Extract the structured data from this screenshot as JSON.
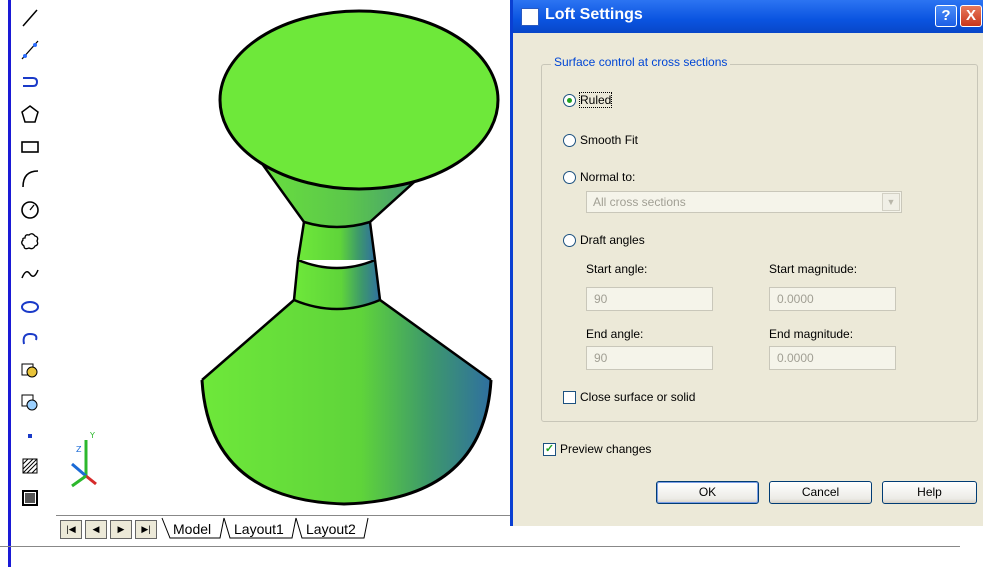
{
  "toolbar": {
    "tools": [
      "line-icon",
      "construction-line-icon",
      "polyline-icon",
      "polygon-icon",
      "rectangle-icon",
      "arc-icon",
      "circle-icon",
      "revision-cloud-icon",
      "spline-icon",
      "ellipse-icon",
      "ellipse-arc-icon",
      "insert-block-icon",
      "make-block-icon",
      "point-icon",
      "hatch-icon",
      "gradient-icon"
    ]
  },
  "viewport": {
    "ucs_labels": {
      "z": "Z",
      "y": "Y"
    }
  },
  "tabs": {
    "items": [
      "Model",
      "Layout1",
      "Layout2"
    ],
    "active": "Model"
  },
  "dialog": {
    "title": "Loft Settings",
    "help_glyph": "?",
    "close_glyph": "X",
    "group_title": "Surface control at cross sections",
    "options": {
      "ruled": "Ruled",
      "smooth_fit": "Smooth Fit",
      "normal_to": "Normal to:",
      "draft_angles": "Draft angles"
    },
    "selected_option": "Ruled",
    "normal_to_value": "All cross sections",
    "start_angle_label": "Start angle:",
    "start_angle_value": "90",
    "start_magnitude_label": "Start magnitude:",
    "start_magnitude_value": "0.0000",
    "end_angle_label": "End angle:",
    "end_angle_value": "90",
    "end_magnitude_label": "End magnitude:",
    "end_magnitude_value": "0.0000",
    "close_surface_label": "Close surface or solid",
    "close_surface_checked": false,
    "preview_label": "Preview changes",
    "preview_checked": true,
    "ok_label": "OK",
    "cancel_label": "Cancel",
    "help_label": "Help"
  },
  "colors": {
    "shape_green": "#6ee83a",
    "shape_dark": "#2f6fa0",
    "title_blue": "#0a54e0",
    "dialog_bg": "#ece9d8"
  }
}
